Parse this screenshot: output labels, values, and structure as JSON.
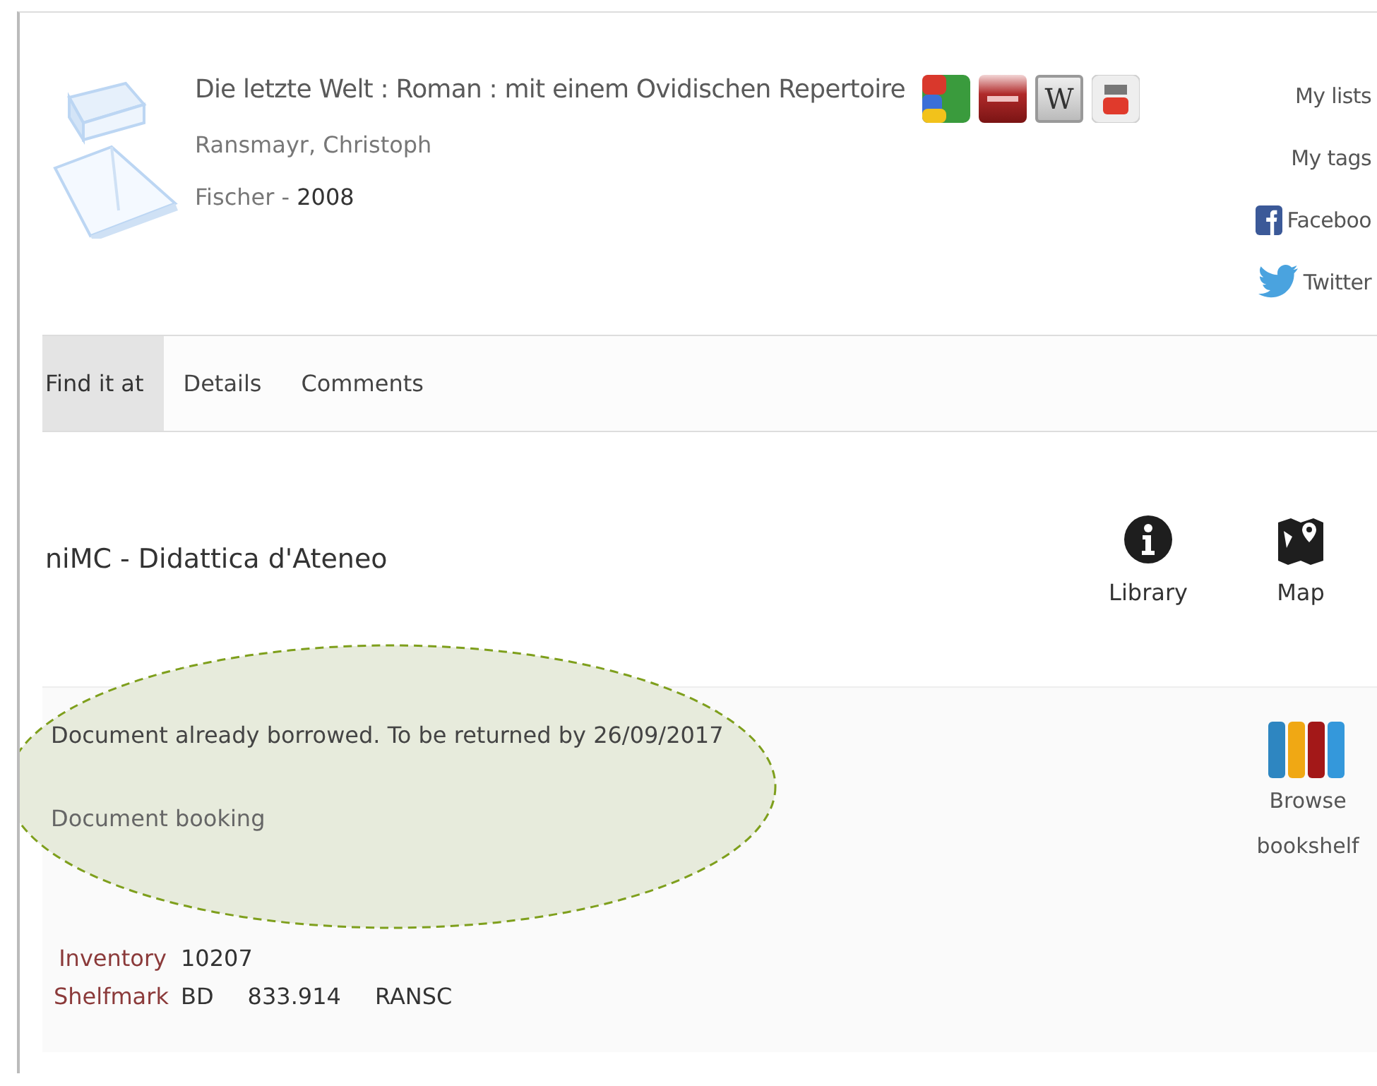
{
  "record": {
    "title": "Die letzte Welt : Roman : mit einem Ovidischen Repertoire",
    "author": "Ransmayr, Christoph",
    "publisher": "Fischer",
    "separator": "-",
    "year": "2008"
  },
  "search_icons": [
    {
      "kind": "google"
    },
    {
      "kind": "red"
    },
    {
      "kind": "wikipedia",
      "label": "W"
    },
    {
      "kind": "youtube"
    }
  ],
  "user_links": [
    {
      "kind": "text",
      "label": "My lists"
    },
    {
      "kind": "text",
      "label": "My tags"
    },
    {
      "kind": "facebook",
      "label": "Faceboo"
    },
    {
      "kind": "twitter",
      "label": "Twitter"
    }
  ],
  "tabs": [
    {
      "label": "Find it at",
      "selected": true
    },
    {
      "label": "Details",
      "selected": false
    },
    {
      "label": "Comments",
      "selected": false
    }
  ],
  "library": {
    "name": "niMC - Didattica d'Ateneo",
    "actions": [
      {
        "kind": "info",
        "label": "Library"
      },
      {
        "kind": "map",
        "label": "Map"
      }
    ]
  },
  "holding": {
    "status": "Document already borrowed. To be returned by 26/09/2017",
    "booking": "Document booking",
    "highlighted": true,
    "bookshelf": [
      "Browse",
      "bookshelf"
    ],
    "fields": [
      {
        "label": "Inventory",
        "values": [
          "10207"
        ]
      },
      {
        "label": "Shelfmark",
        "values": [
          "BD",
          "833.914",
          "RANSC"
        ]
      }
    ]
  }
}
